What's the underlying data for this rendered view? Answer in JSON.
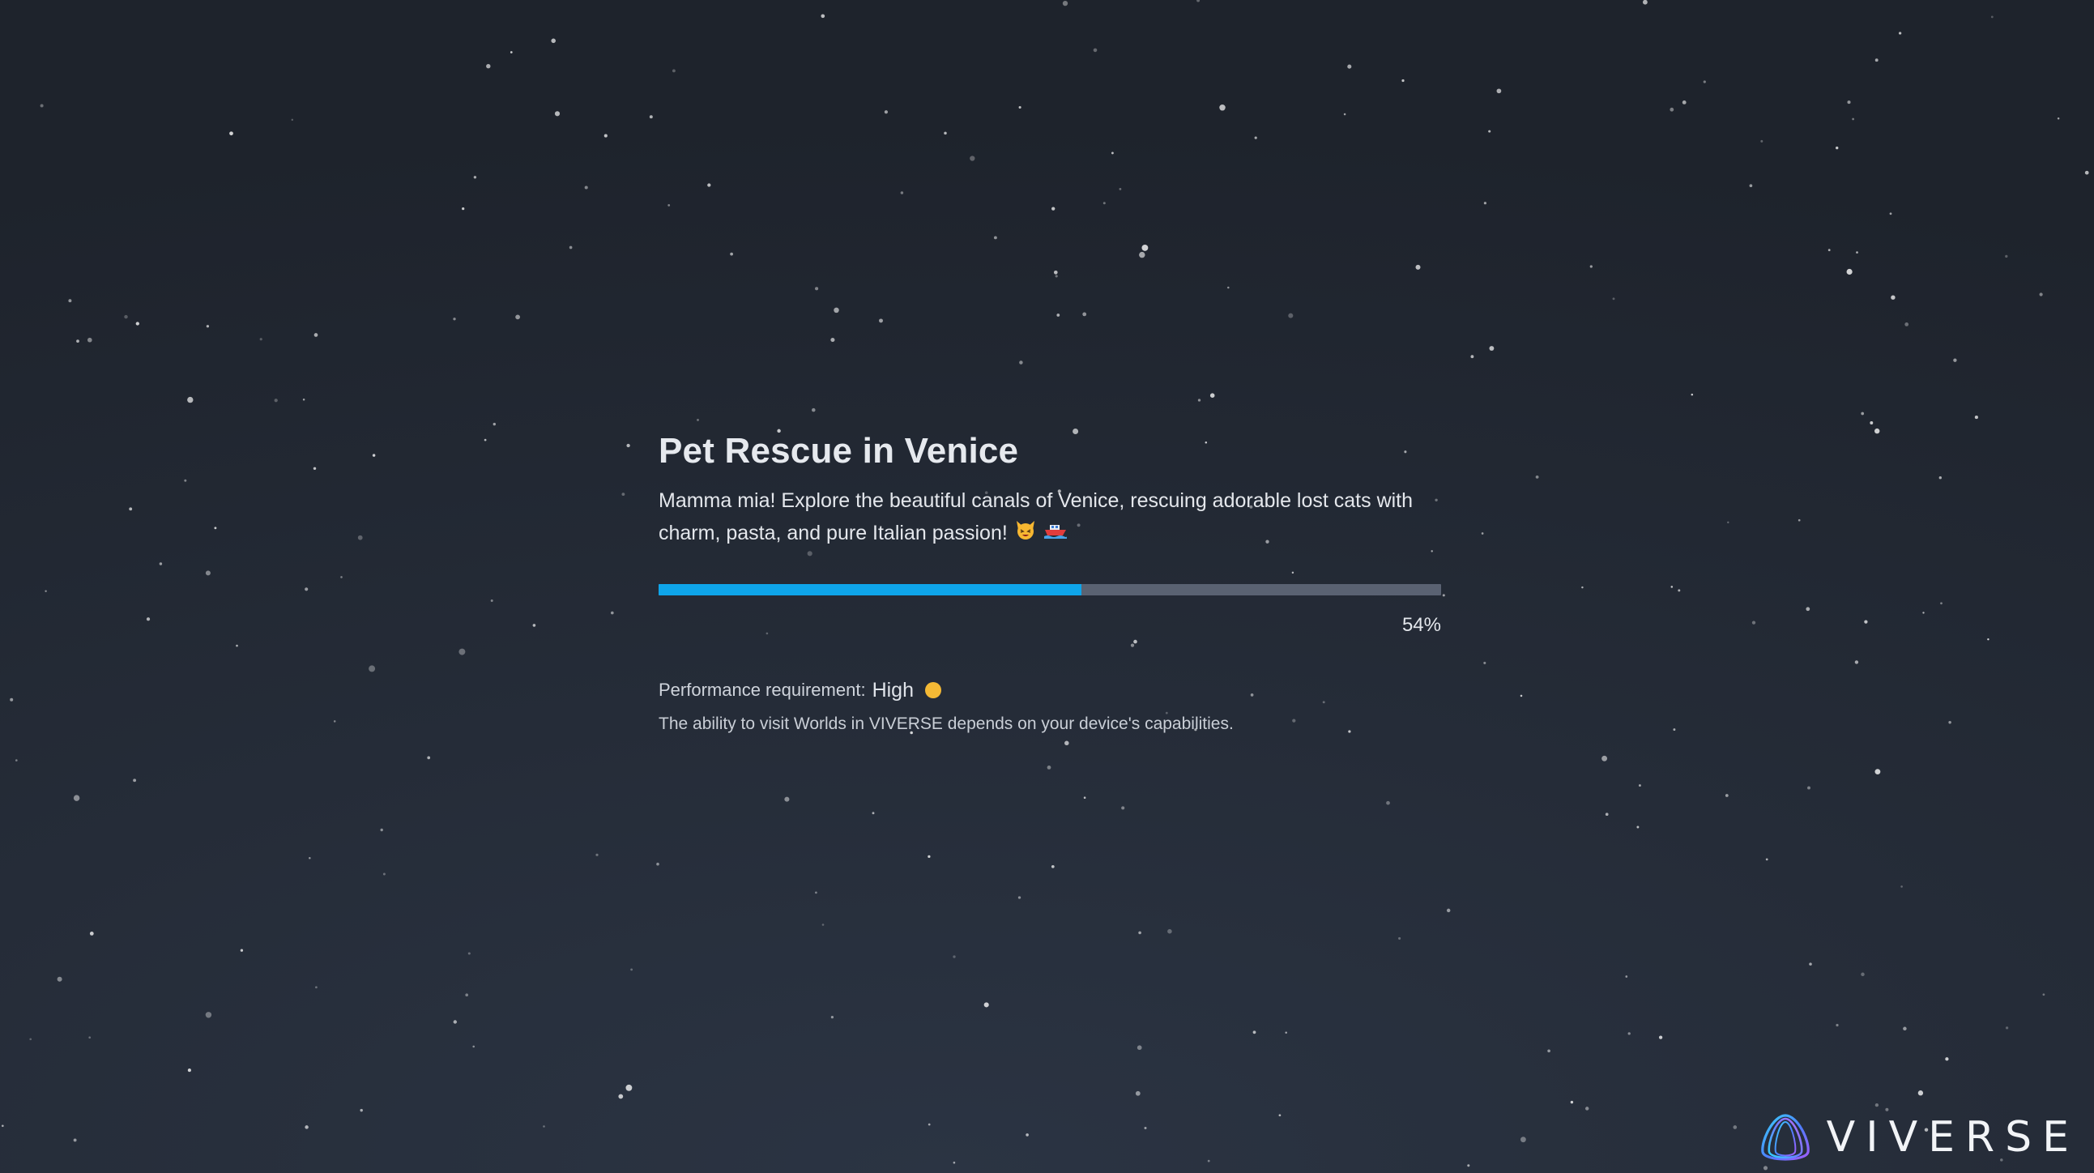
{
  "world": {
    "title": "Pet Rescue in Venice",
    "description": "Mamma mia! Explore the beautiful canals of Venice, rescuing adorable lost cats with charm, pasta, and pure Italian passion!",
    "description_emojis": [
      "cat-face-emoji",
      "boat-emoji"
    ]
  },
  "progress": {
    "value": 54,
    "label": "54%"
  },
  "performance": {
    "label": "Performance requirement:",
    "level": "High",
    "level_indicator_icon": "yellow-circle-icon",
    "note": "The ability to visit Worlds in VIVERSE depends on your device's capabilities."
  },
  "brand": {
    "name": "VIVERSE",
    "logo_icon": "viverse-logo-icon"
  },
  "colors": {
    "background": "#232a35",
    "progress_fill": "#0ea5ea",
    "progress_track": "#5a6272",
    "level_high": "#f4b935"
  }
}
